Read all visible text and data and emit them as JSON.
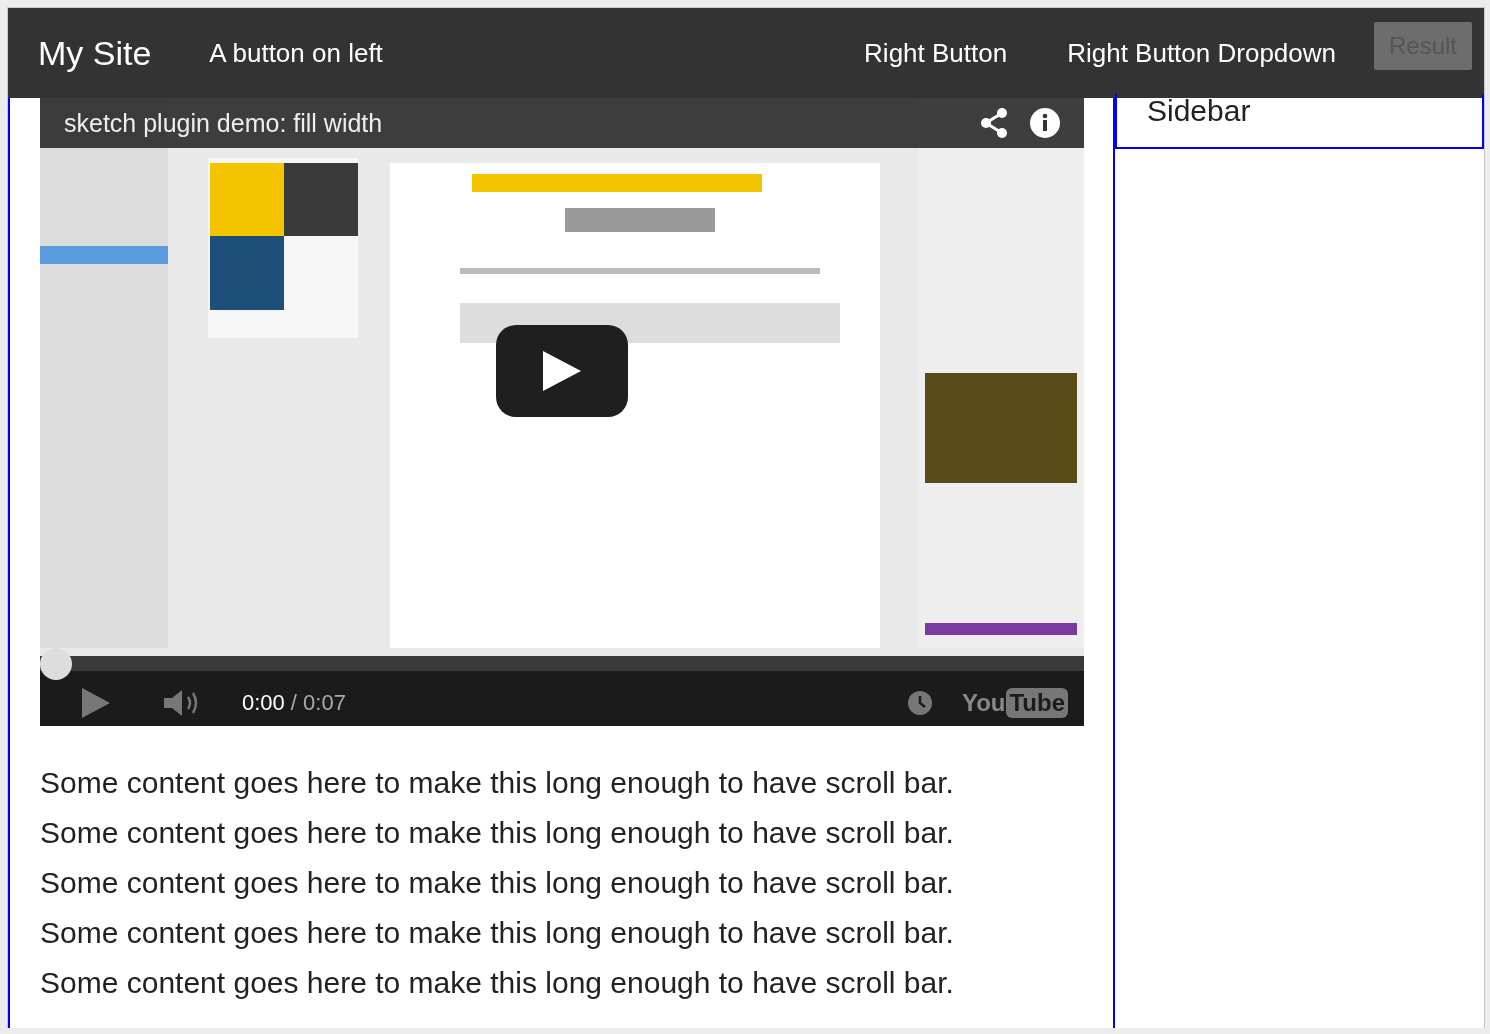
{
  "navbar": {
    "brand": "My Site",
    "left_button": "A button on left",
    "right_button": "Right Button",
    "right_dropdown": "Right Button Dropdown"
  },
  "result_badge": "Result",
  "video": {
    "title": "sketch plugin demo: fill width",
    "current_time": "0:00",
    "duration": "/ 0:07",
    "progress": {
      "level": 0
    },
    "logo": [
      "You",
      "Tube"
    ]
  },
  "content": [
    "Some content goes here to make this long enough to have scroll bar.",
    "Some content goes here to make this long enough to have scroll bar.",
    "Some content goes here to make this long enough to have scroll bar.",
    "Some content goes here to make this long enough to have scroll bar.",
    "Some content goes here to make this long enough to have scroll bar."
  ],
  "sidebar": {
    "title": "Sidebar"
  }
}
